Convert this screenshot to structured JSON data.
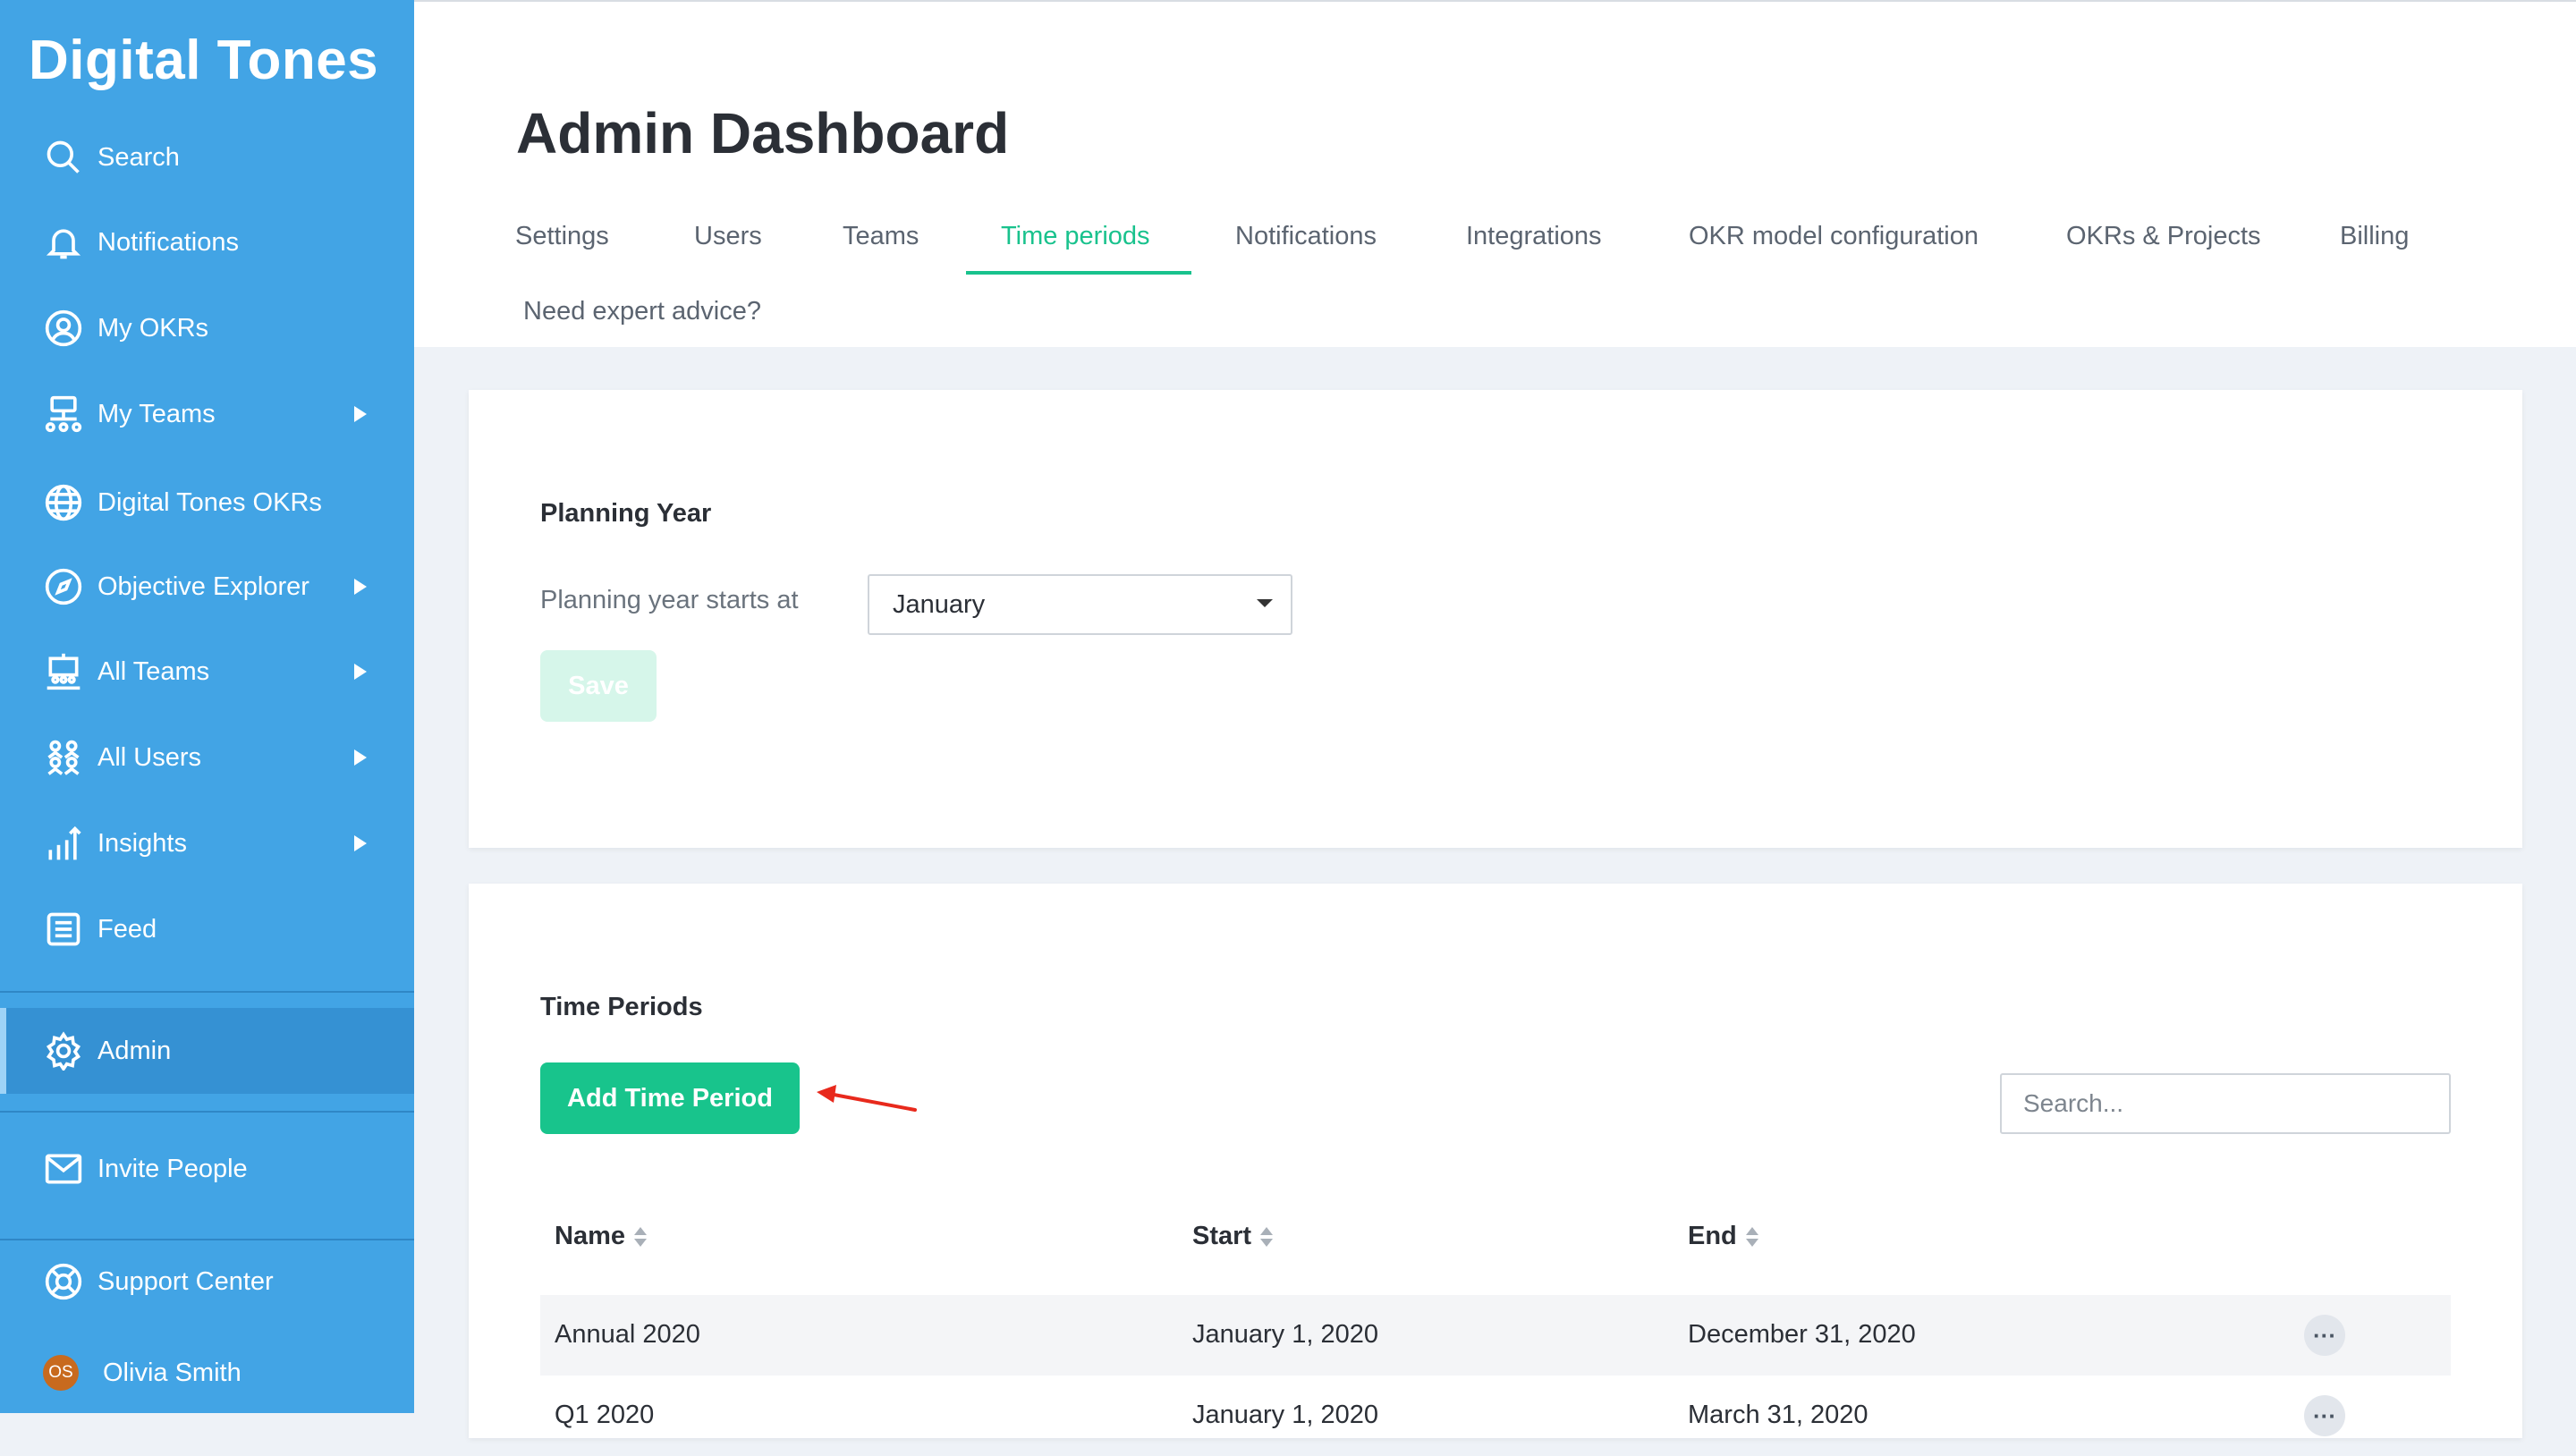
{
  "sidebar": {
    "brand": "Digital Tones",
    "items": [
      {
        "label": "Search"
      },
      {
        "label": "Notifications"
      },
      {
        "label": "My OKRs"
      },
      {
        "label": "My Teams"
      },
      {
        "label": "Digital Tones OKRs"
      },
      {
        "label": "Objective Explorer"
      },
      {
        "label": "All Teams"
      },
      {
        "label": "All Users"
      },
      {
        "label": "Insights"
      },
      {
        "label": "Feed"
      },
      {
        "label": "Admin"
      },
      {
        "label": "Invite People"
      },
      {
        "label": "Support Center"
      }
    ],
    "user": {
      "initials": "OS",
      "name": "Olivia Smith"
    },
    "colors": {
      "background": "#42a4e5",
      "active": "#3591d3"
    }
  },
  "header": {
    "title": "Admin Dashboard",
    "tabs": [
      {
        "label": "Settings"
      },
      {
        "label": "Users"
      },
      {
        "label": "Teams"
      },
      {
        "label": "Time periods"
      },
      {
        "label": "Notifications"
      },
      {
        "label": "Integrations"
      },
      {
        "label": "OKR model configuration"
      },
      {
        "label": "OKRs & Projects"
      },
      {
        "label": "Billing"
      },
      {
        "label": "Need expert advice?"
      }
    ],
    "active_tab": "Time periods",
    "accent_color": "#19c28d"
  },
  "planning": {
    "title": "Planning Year",
    "field_label": "Planning year starts at",
    "selected_month": "January",
    "save_label": "Save"
  },
  "time_periods": {
    "title": "Time Periods",
    "add_label": "Add Time Period",
    "search_placeholder": "Search...",
    "columns": [
      "Name",
      "Start",
      "End"
    ],
    "rows": [
      {
        "name": "Annual 2020",
        "start": "January 1, 2020",
        "end": "December 31, 2020"
      },
      {
        "name": "Q1 2020",
        "start": "January 1, 2020",
        "end": "March 31, 2020"
      }
    ]
  },
  "annotation_color": "#e8291c"
}
